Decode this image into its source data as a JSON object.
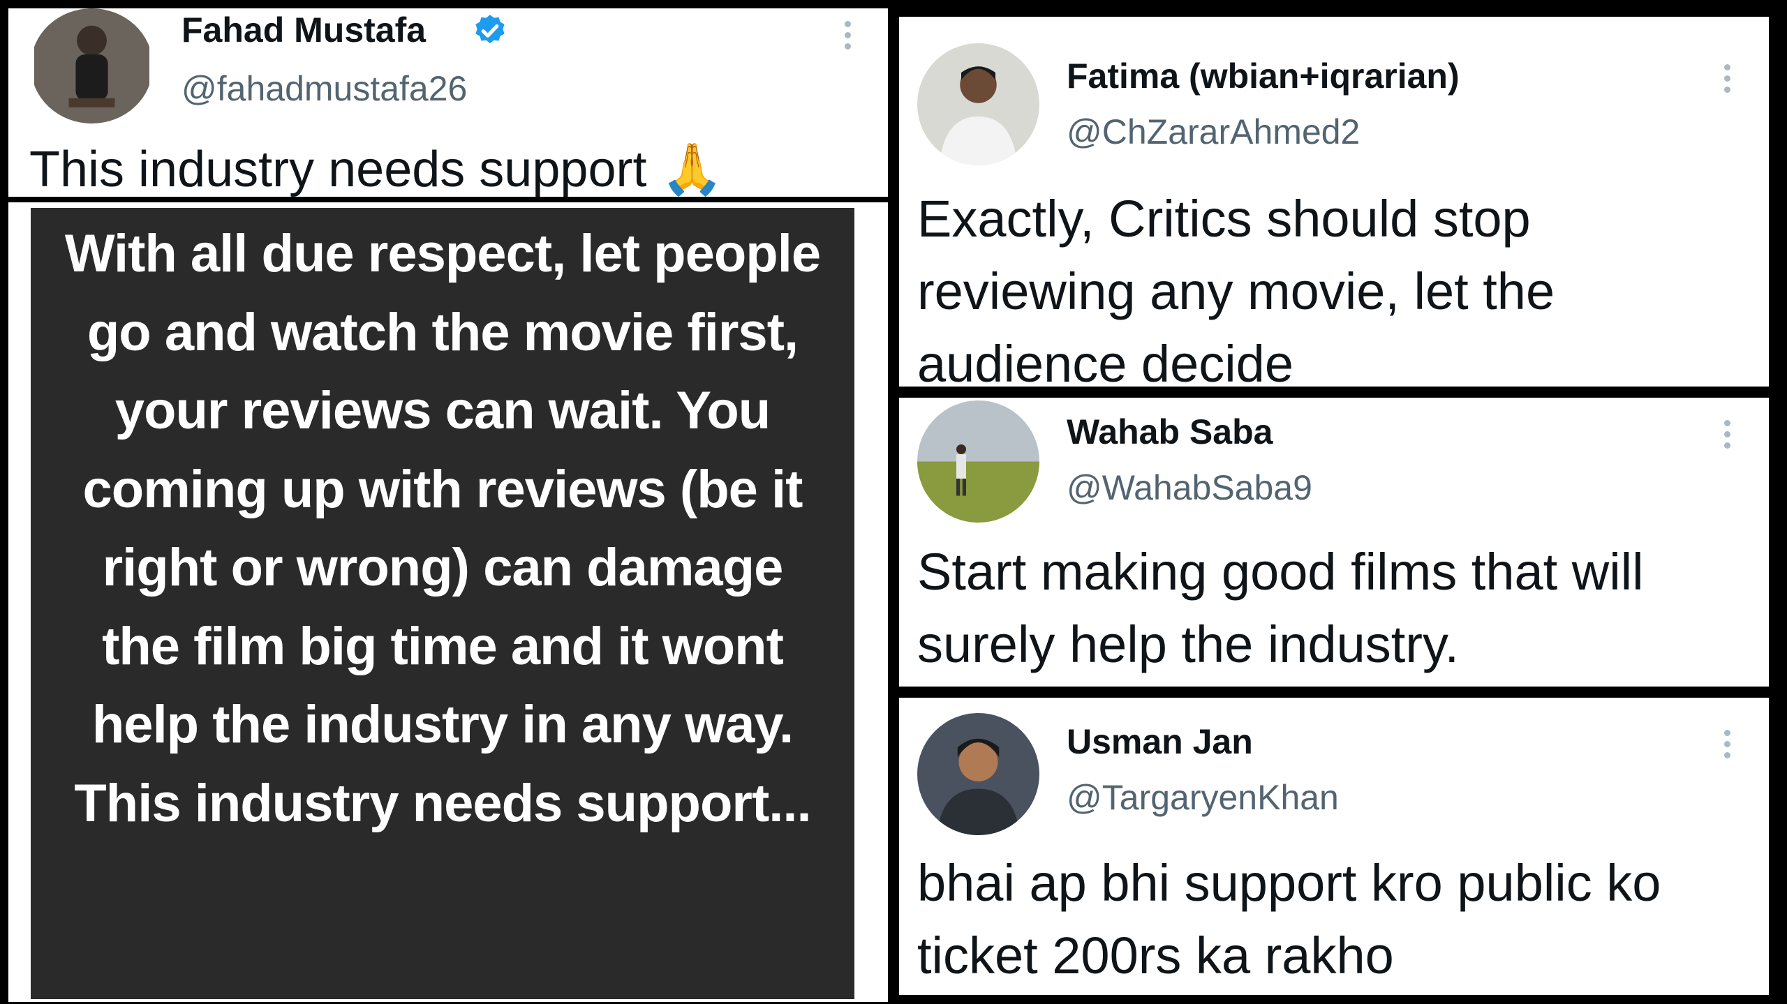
{
  "main_tweet": {
    "author_name": "Fahad Mustafa",
    "handle": "@fahadmustafa26",
    "text": "This industry needs support 🙏",
    "verified": true,
    "avatar_icon": "profile-photo"
  },
  "notes_screenshot": {
    "text": "With all due respect, let people go and watch the movie first, your reviews can wait. You coming up with reviews (be it right or wrong) can damage the film big time and it wont help the industry in any way. This industry needs support..."
  },
  "replies": [
    {
      "author_name": "Fatima (wbian+iqrarian)",
      "handle": "@ChZararAhmed2",
      "text": "Exactly, Critics should stop reviewing any movie, let the audience decide"
    },
    {
      "author_name": "Wahab Saba",
      "handle": "@WahabSaba9",
      "text": "Start making good films that will surely help the industry."
    },
    {
      "author_name": "Usman Jan",
      "handle": "@TargaryenKhan",
      "text": "bhai ap bhi support kro public ko ticket 200rs ka rakho"
    }
  ],
  "colors": {
    "verified_blue": "#1d9bf0",
    "handle_gray": "#536471",
    "notes_background": "#2a2a2a"
  }
}
